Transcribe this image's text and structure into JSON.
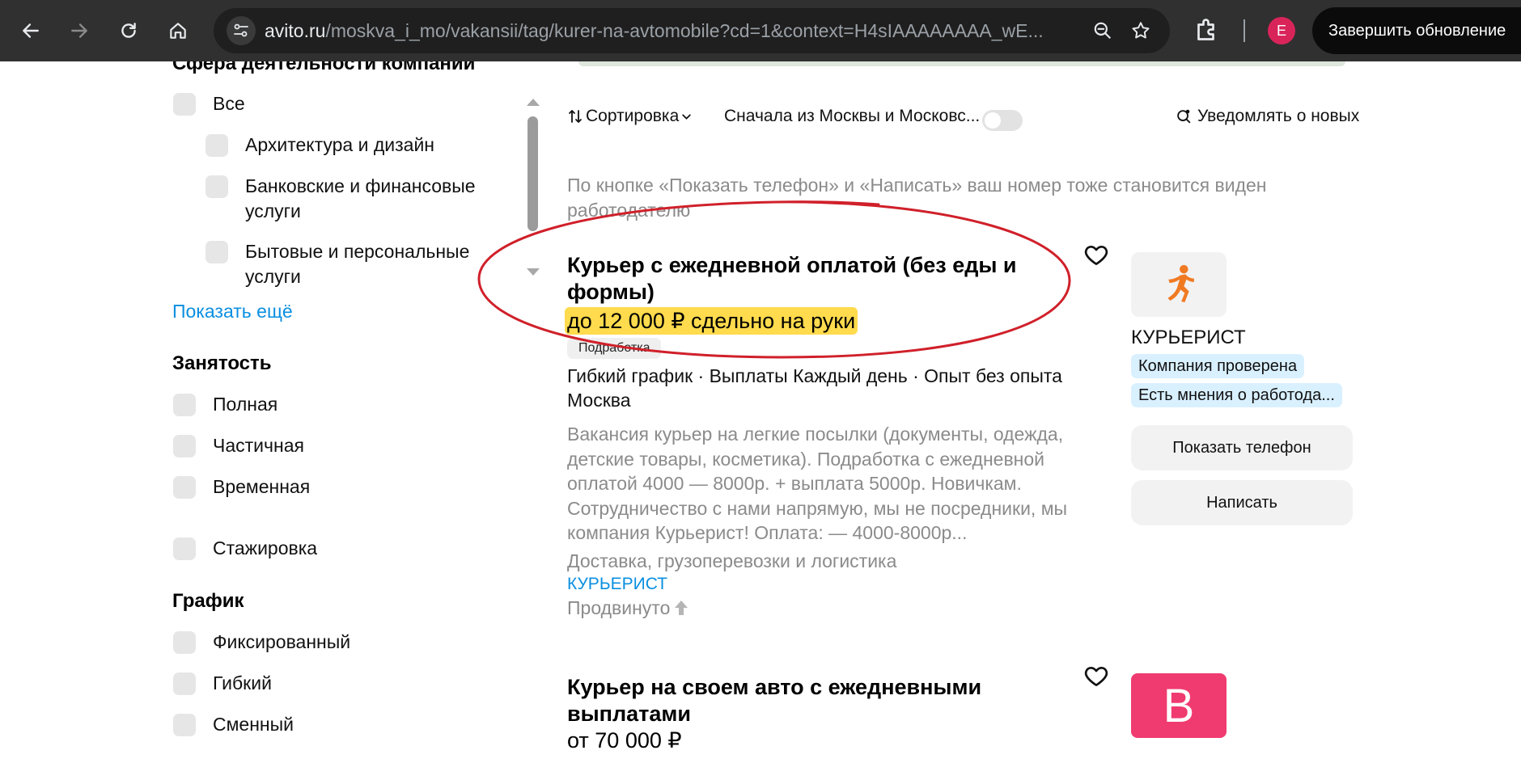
{
  "browser": {
    "url_host": "avito.ru",
    "url_path": "/moskva_i_mo/vakansii/tag/kurer-na-avtomobile?cd=1&context=H4sIAAAAAAAA_wE...",
    "profile_initial": "E",
    "update_button": "Завершить обновление",
    "colors": {
      "chrome_bg": "#303030",
      "omnibox_bg": "#1f1f1f",
      "profile": "#d9245a"
    }
  },
  "filters": {
    "activity": {
      "title": "Сфера деятельности компании",
      "items": [
        {
          "label": "Все",
          "checked": false
        },
        {
          "label": "Архитектура и дизайн",
          "checked": false
        },
        {
          "label": "Банковские и финансовые услуги",
          "checked": false
        },
        {
          "label": "Бытовые и персональные услуги",
          "checked": false
        }
      ],
      "show_more": "Показать ещё"
    },
    "employment": {
      "title": "Занятость",
      "items": [
        {
          "label": "Полная",
          "checked": false
        },
        {
          "label": "Частичная",
          "checked": false
        },
        {
          "label": "Временная",
          "checked": false
        },
        {
          "label": "Стажировка",
          "checked": false
        }
      ]
    },
    "schedule": {
      "title": "График",
      "items": [
        {
          "label": "Фиксированный",
          "checked": false
        },
        {
          "label": "Гибкий",
          "checked": false
        },
        {
          "label": "Сменный",
          "checked": false
        }
      ]
    }
  },
  "toolbar": {
    "sort_label": "Сортировка",
    "region_label": "Сначала из Москвы и Московс...",
    "region_toggle_on": false,
    "notify_label": "Уведомлять о новых"
  },
  "notice": "По кнопке «Показать телефон» и «Написать» ваш номер тоже становится виден работодателю",
  "listings": [
    {
      "title": "Курьер с ежедневной оплатой (без еды и формы)",
      "salary": "до 12 000 ₽ сдельно на руки",
      "chip": "Подработка",
      "meta": "Гибкий график · Выплаты Каждый день · Опыт без опыта",
      "location": "Москва",
      "description": "Вакансия курьер на легкие посылки (документы, одежда, детские товары, косметика). Подработка с ежедневной оплатой 4000 — 8000р. + выплата 5000р. Новичкам. Сотрудничество с нами напрямую, мы не посредники, мы компания Курьерист! Оплата: — 4000-8000р...",
      "category": "Доставка, грузоперевозки и логистика",
      "company": "КУРЬЕРИСТ",
      "promo": "Продвинуто",
      "seller": {
        "name": "КУРЬЕРИСТ",
        "badges": [
          "Компания проверена",
          "Есть мнения о работода..."
        ],
        "show_phone": "Показать телефон",
        "write": "Написать"
      }
    },
    {
      "title": "Курьер на своем авто с ежедневными выплатами",
      "salary": "от 70 000 ₽",
      "seller": {
        "logo_letter": "B",
        "logo_color": "#f03b70"
      }
    }
  ],
  "annotation": {
    "color": "#d0202a",
    "shape": "ellipse-around-first-listing-title"
  }
}
